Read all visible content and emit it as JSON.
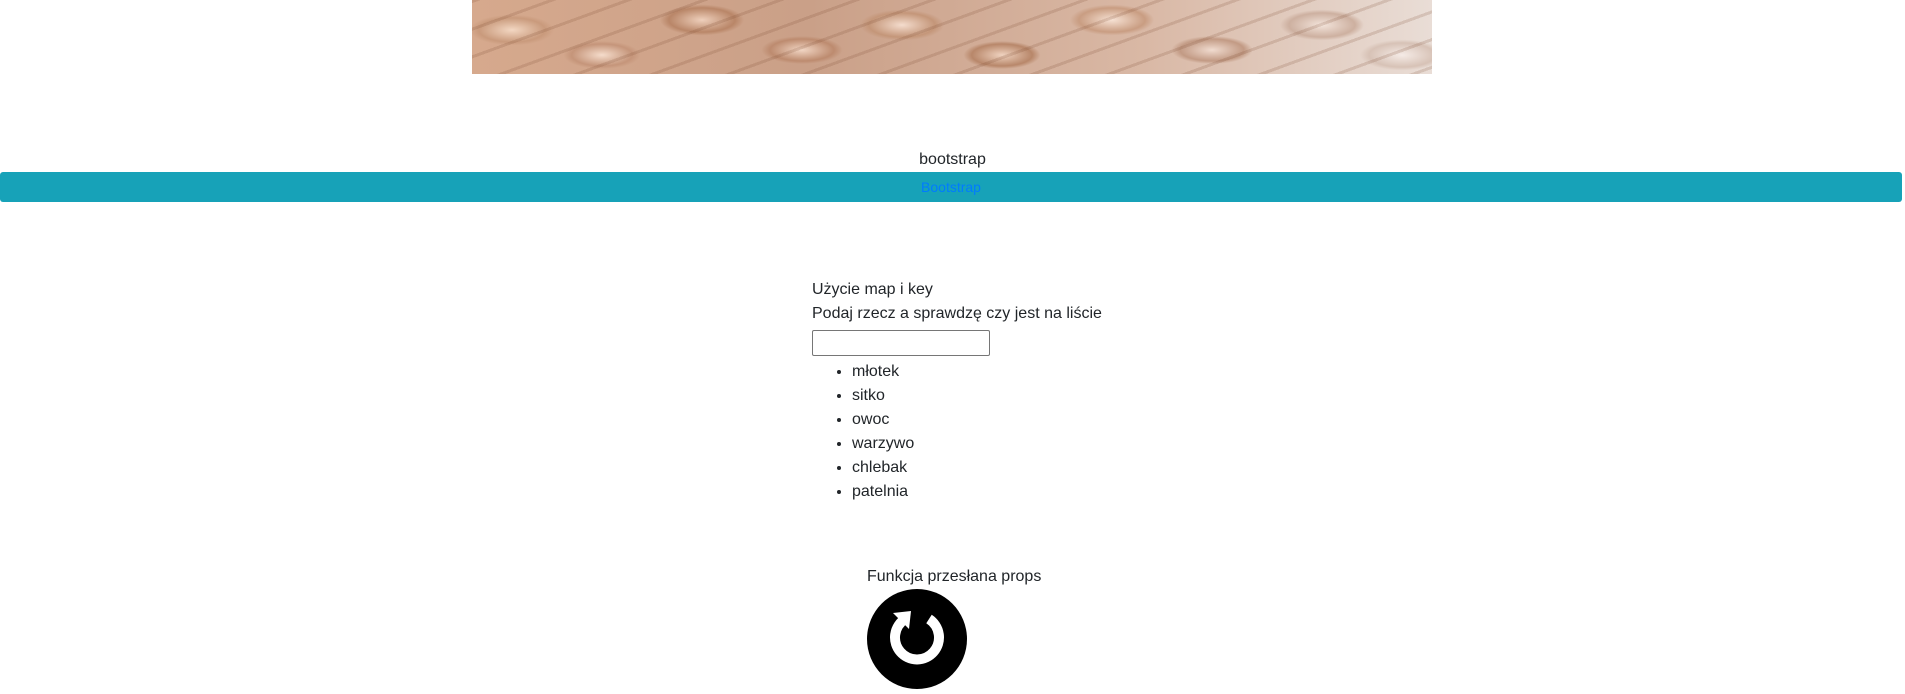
{
  "hero": {
    "icon": "knitted-texture-image"
  },
  "bootstrap_section": {
    "label": "bootstrap",
    "button_label": "Bootstrap",
    "bar_color": "#17a2b8",
    "link_color": "#007bff"
  },
  "map_section": {
    "title": "Użycie map i key",
    "description": "Podaj rzecz a sprawdzę czy jest na liście",
    "input_value": "",
    "items": [
      "młotek",
      "sitko",
      "owoc",
      "warzywo",
      "chlebak",
      "patelnia"
    ]
  },
  "props_section": {
    "title": "Funkcja przesłana props",
    "icon": "reload-icon"
  }
}
